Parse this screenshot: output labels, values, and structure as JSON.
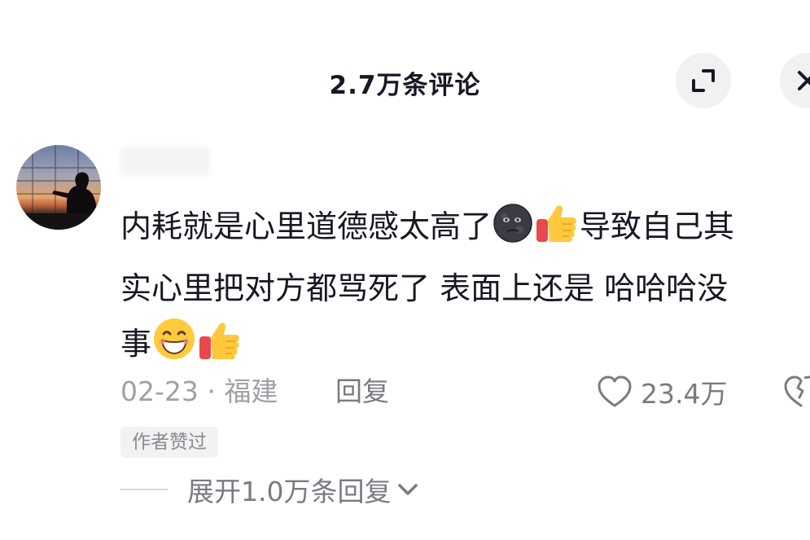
{
  "header": {
    "title": "2.7万条评论"
  },
  "comment": {
    "line1_before": "内耗就是心里道德感太高了",
    "line1_after": "导致自己其",
    "line2": "实心里把对方都骂死了 表面上还是 哈哈哈没",
    "line3": "事",
    "date": "02-23",
    "separator": "·",
    "location": "福建",
    "reply_label": "回复",
    "like_count": "23.4万",
    "badge": "作者赞过",
    "expand_label": "展开1.0万条回复"
  },
  "colors": {
    "text": "#161823",
    "secondary": "#7a7a84",
    "meta": "#a0a0a8",
    "button_bg": "#f1f1f2"
  }
}
